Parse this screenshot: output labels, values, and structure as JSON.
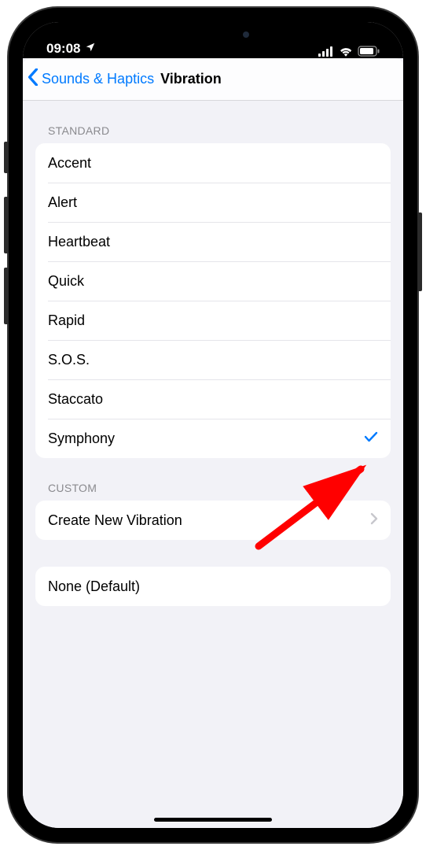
{
  "status": {
    "time": "09:08",
    "location_icon": "location-arrow-icon",
    "cell_icon": "cellular-signal-icon",
    "wifi_icon": "wifi-icon",
    "battery_icon": "battery-icon"
  },
  "nav": {
    "back_label": "Sounds & Haptics",
    "title": "Vibration"
  },
  "sections": {
    "standard": {
      "header": "STANDARD",
      "items": [
        {
          "label": "Accent",
          "selected": false
        },
        {
          "label": "Alert",
          "selected": false
        },
        {
          "label": "Heartbeat",
          "selected": false
        },
        {
          "label": "Quick",
          "selected": false
        },
        {
          "label": "Rapid",
          "selected": false
        },
        {
          "label": "S.O.S.",
          "selected": false
        },
        {
          "label": "Staccato",
          "selected": false
        },
        {
          "label": "Symphony",
          "selected": true
        }
      ]
    },
    "custom": {
      "header": "CUSTOM",
      "create_label": "Create New Vibration"
    },
    "none": {
      "label": "None (Default)"
    }
  },
  "colors": {
    "accent": "#007aff",
    "bg": "#f2f2f7",
    "separator": "#e5e5ea",
    "secondary_text": "#8a8a8e",
    "annotation": "#ff0000"
  }
}
